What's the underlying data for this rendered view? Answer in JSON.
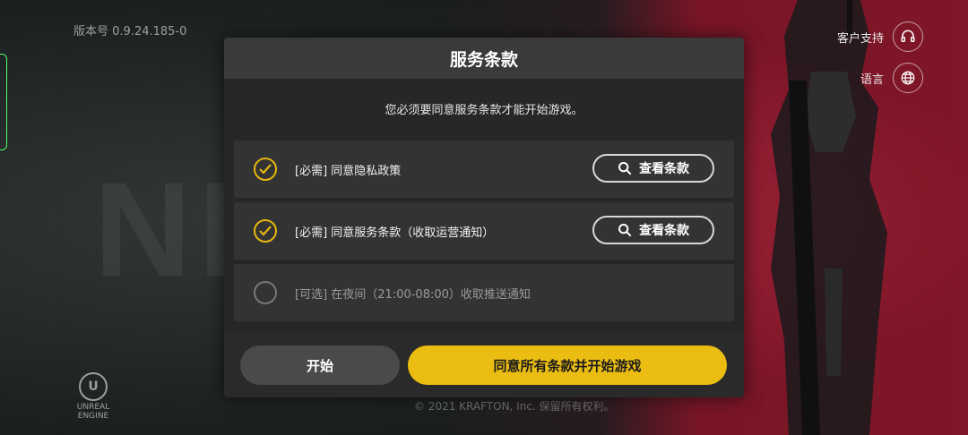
{
  "app": {
    "version_label": "版本号 0.9.24.185-0",
    "support_label": "客户支持",
    "language_label": "语言",
    "background_text": "NEW",
    "engine_logo": "UNREAL ENGINE",
    "copyright": "© 2021 KRAFTON, Inc. 保留所有权利。"
  },
  "dialog": {
    "title": "服务条款",
    "subtitle": "您必须要同意服务条款才能开始游戏。",
    "items": [
      {
        "label": "[必需] 同意隐私政策",
        "checked": true,
        "button": "查看条款"
      },
      {
        "label": "[必需] 同意服务条款（收取运营通知）",
        "checked": true,
        "button": "查看条款"
      },
      {
        "label": "[可选] 在夜间（21:00-08:00）收取推送通知",
        "checked": false
      }
    ],
    "start_button": "开始",
    "agree_all_button": "同意所有条款并开始游戏"
  },
  "colors": {
    "accent_yellow": "#ebbd12",
    "dialog_bg": "#272727",
    "background_red": "#c4213d"
  }
}
